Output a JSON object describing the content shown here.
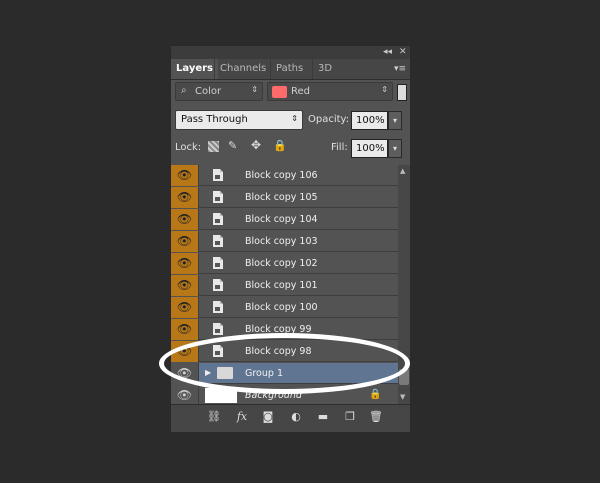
{
  "panel": {
    "tabs": [
      {
        "label": "Layers",
        "active": true
      },
      {
        "label": "Channels",
        "active": false
      },
      {
        "label": "Paths",
        "active": false
      },
      {
        "label": "3D",
        "active": false
      }
    ],
    "collapse_label": "◂◂",
    "close_label": "✕",
    "menu_label": "▾≡"
  },
  "filter": {
    "kind_label": "Color",
    "color_name": "Red",
    "color_hex": "#ff6b6b"
  },
  "blend": {
    "mode": "Pass Through",
    "opacity_label": "Opacity:",
    "opacity_value": "100%"
  },
  "lock": {
    "label": "Lock:",
    "fill_label": "Fill:",
    "fill_value": "100%"
  },
  "layers": [
    {
      "name": "Block copy 106",
      "type": "smart",
      "visible": true
    },
    {
      "name": "Block copy 105",
      "type": "smart",
      "visible": true
    },
    {
      "name": "Block copy 104",
      "type": "smart",
      "visible": true
    },
    {
      "name": "Block copy 103",
      "type": "smart",
      "visible": true
    },
    {
      "name": "Block copy 102",
      "type": "smart",
      "visible": true
    },
    {
      "name": "Block copy 101",
      "type": "smart",
      "visible": true
    },
    {
      "name": "Block copy 100",
      "type": "smart",
      "visible": true
    },
    {
      "name": "Block copy 99",
      "type": "smart",
      "visible": true
    },
    {
      "name": "Block copy 98",
      "type": "smart",
      "visible": true
    },
    {
      "name": "Group 1",
      "type": "group",
      "visible": true,
      "selected": true
    },
    {
      "name": "Background",
      "type": "background",
      "visible": true,
      "locked": true
    }
  ],
  "colors": {
    "highlight": "#b87818",
    "selected_row": "#5f7592",
    "panel_bg": "#535353"
  }
}
